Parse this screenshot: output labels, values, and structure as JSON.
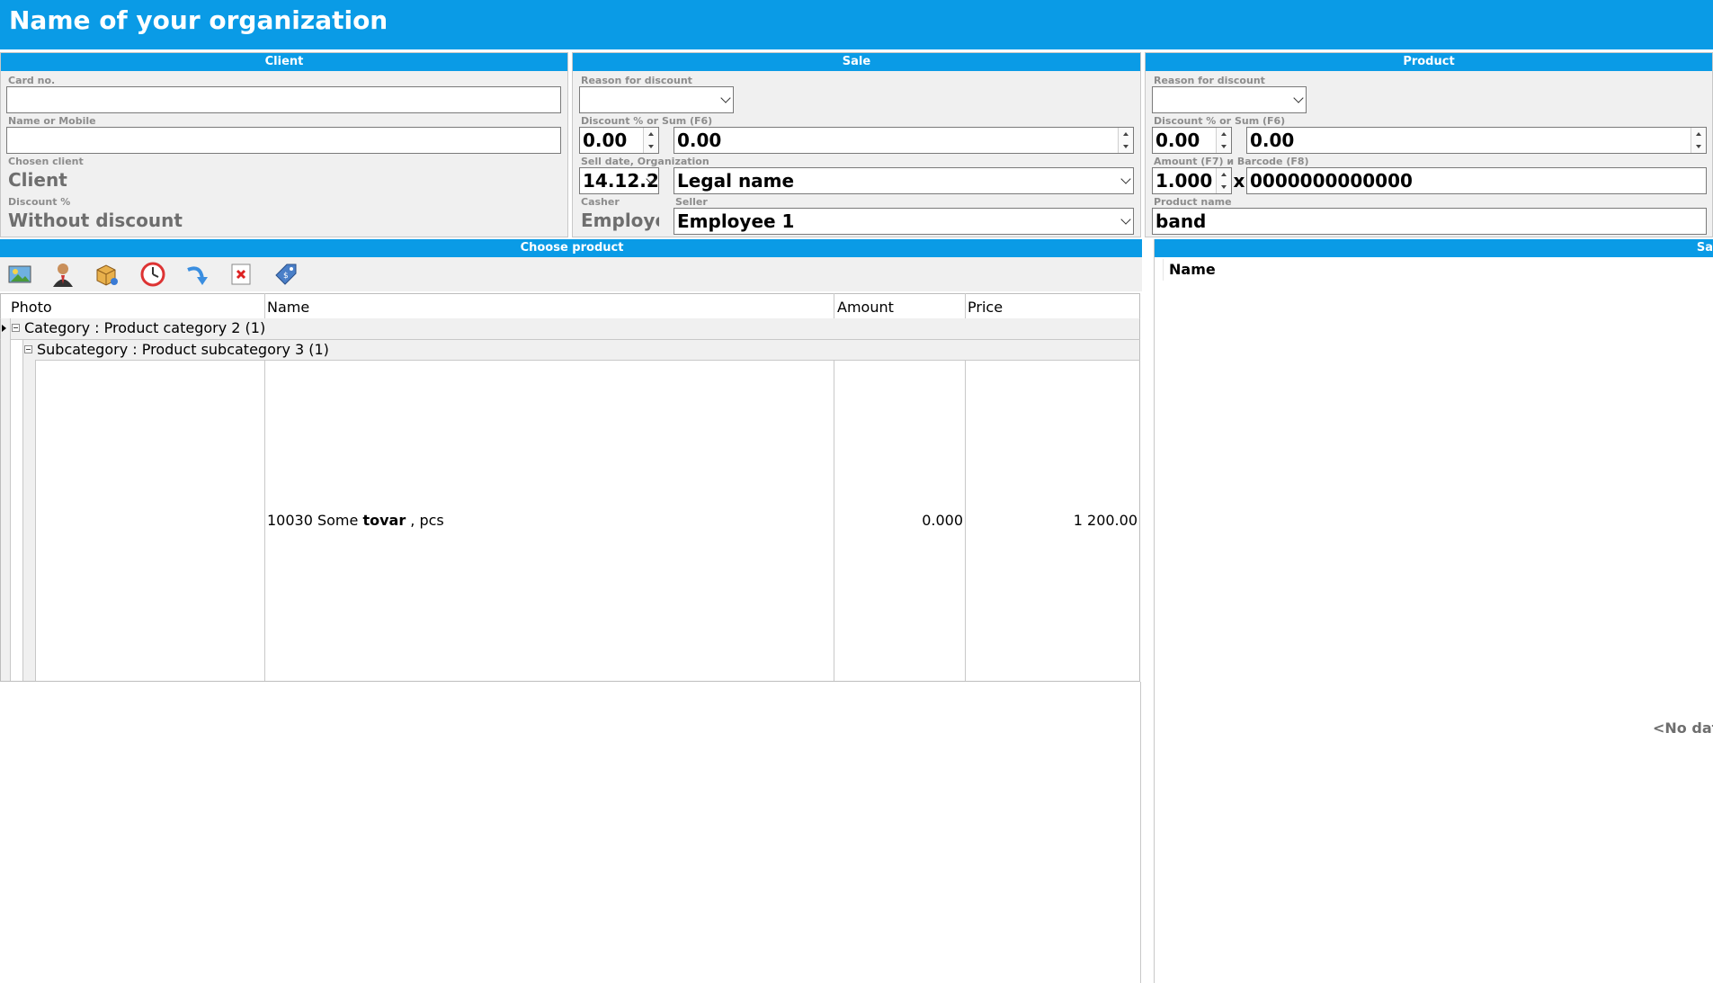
{
  "app": {
    "title": "Name of your organization"
  },
  "client": {
    "header": "Client",
    "card_label": "Card no.",
    "card_value": "",
    "name_label": "Name or Mobile",
    "name_value": "",
    "chosen_label": "Chosen client",
    "chosen_value": "Client",
    "discount_label": "Discount %",
    "discount_value": "Without discount"
  },
  "sale": {
    "header": "Sale",
    "reason_label": "Reason for discount",
    "reason_value": "",
    "discount_label": "Discount % or Sum (F6)",
    "discount_percent": "0.00",
    "discount_sum": "0.00",
    "date_label": "Sell date, Organization",
    "date_value": "14.12.2",
    "organization_value": "Legal name",
    "casher_label": "Casher",
    "casher_value": "Employe",
    "seller_label": "Seller",
    "seller_value": "Employee 1"
  },
  "product": {
    "header": "Product",
    "reason_label": "Reason for discount",
    "reason_value": "",
    "discount_label": "Discount % or Sum (F6)",
    "discount_percent": "0.00",
    "discount_sum": "0.00",
    "amount_label": "Amount (F7) и Barcode (F8)",
    "amount_value": "1.000",
    "multiply_sign": "x",
    "barcode_value": "0000000000000",
    "name_label": "Product name",
    "name_value": "band"
  },
  "choose_product": {
    "header": "Choose product",
    "toolbar": [
      "photo-icon",
      "client-icon",
      "product-box-icon",
      "clock-icon",
      "return-arrow-icon",
      "delete-icon",
      "price-tag-icon"
    ],
    "columns": {
      "photo": "Photo",
      "name": "Name",
      "amount": "Amount",
      "price": "Price"
    },
    "category_row": "Category : Product category 2 (1)",
    "subcategory_row": "Subcategory : Product subcategory 3 (1)",
    "rows": [
      {
        "name_prefix": "10030 Some ",
        "name_bold": "tovar",
        "name_suffix": " , pcs",
        "amount": "0.000",
        "price": "1 200.00"
      }
    ]
  },
  "sale_list": {
    "header": "Sa",
    "column_name": "Name",
    "empty_text": "<No dat"
  },
  "colors": {
    "accent": "#0a9be6",
    "panel": "#f0f0f0",
    "label": "#8c8c8c"
  }
}
